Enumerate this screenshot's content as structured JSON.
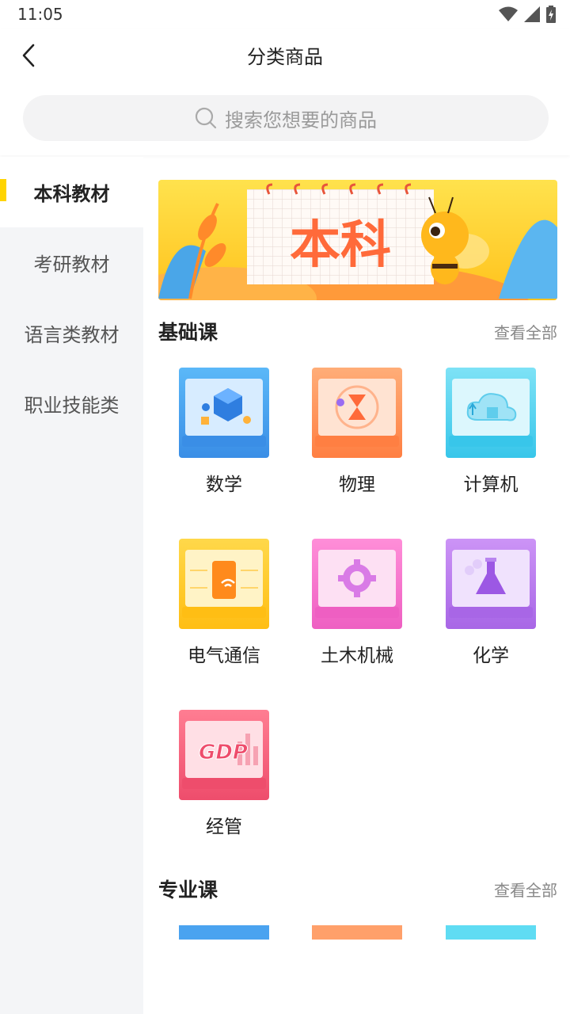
{
  "status": {
    "time": "11:05"
  },
  "header": {
    "title": "分类商品"
  },
  "search": {
    "placeholder": "搜索您想要的商品"
  },
  "sidebar": {
    "items": [
      {
        "label": "本科教材",
        "active": true
      },
      {
        "label": "考研教材",
        "active": false
      },
      {
        "label": "语言类教材",
        "active": false
      },
      {
        "label": "职业技能类",
        "active": false
      }
    ]
  },
  "banner": {
    "text": "本科"
  },
  "sections": [
    {
      "title": "基础课",
      "more": "查看全部",
      "categories": [
        {
          "label": "数学",
          "color": "#4aa3f0"
        },
        {
          "label": "物理",
          "color": "#ff9a5c"
        },
        {
          "label": "计算机",
          "color": "#5cd4ee"
        },
        {
          "label": "电气通信",
          "color": "#ffc928"
        },
        {
          "label": "土木机械",
          "color": "#f27bd0"
        },
        {
          "label": "化学",
          "color": "#b77ee8"
        },
        {
          "label": "经管",
          "color": "#f36b84",
          "text": "GDP"
        }
      ]
    },
    {
      "title": "专业课",
      "more": "查看全部"
    }
  ]
}
